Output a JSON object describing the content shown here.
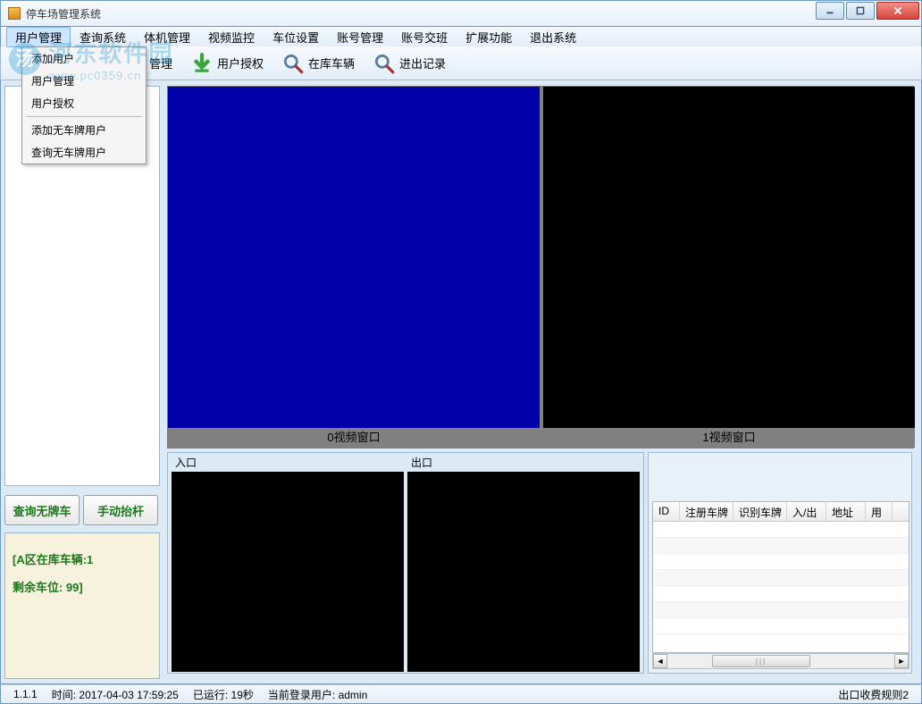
{
  "watermark": {
    "cn": "河东软件园",
    "url": "www.pc0359.cn"
  },
  "window": {
    "title": "停车场管理系统"
  },
  "menubar": {
    "items": [
      "用户管理",
      "查询系统",
      "体机管理",
      "视频监控",
      "车位设置",
      "账号管理",
      "账号交班",
      "扩展功能",
      "退出系统"
    ]
  },
  "dropdown": {
    "items_a": [
      "添加用户",
      "用户管理",
      "用户授权"
    ],
    "items_b": [
      "添加无车牌用户",
      "查询无车牌用户"
    ]
  },
  "toolbar": {
    "manage": "管理",
    "user_auth": "用户授权",
    "in_stock": "在库车辆",
    "in_out_log": "进出记录"
  },
  "left_buttons": {
    "query_noplate": "查询无牌车",
    "manual_lift": "手动抬杆"
  },
  "left_status": {
    "line1": "[A区在库车辆:1",
    "line2": "剩余车位: 99]"
  },
  "video": {
    "label0": "0视频窗口",
    "label1": "1视频窗口"
  },
  "io": {
    "in_label": "入口",
    "out_label": "出口"
  },
  "table": {
    "headers": [
      "ID",
      "注册车牌",
      "识别车牌",
      "入/出",
      "地址",
      "用"
    ]
  },
  "status": {
    "version": "1.1.1",
    "time_label": "时间:",
    "time_value": "2017-04-03 17:59:25",
    "runtime_label": "已运行:",
    "runtime_value": "19秒",
    "user_label": "当前登录用户:",
    "user_value": "admin",
    "rule": "出口收费规则2"
  }
}
